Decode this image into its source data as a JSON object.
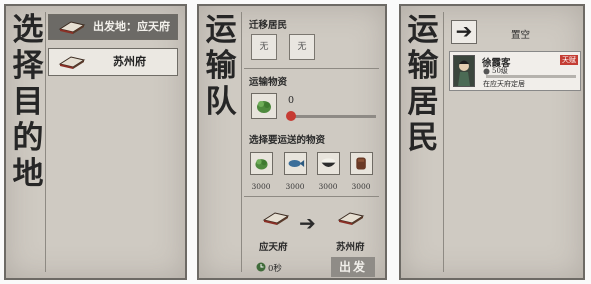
{
  "panel1": {
    "title": [
      "选",
      "择",
      "目",
      "的",
      "地"
    ],
    "origin_label": "出发地：应天府",
    "target_label": "苏州府"
  },
  "panel2": {
    "title": [
      "运",
      "输",
      "队"
    ],
    "migrate_label": "迁移居民",
    "slot_glyph": "无",
    "goods_label": "运输物资",
    "slider_value": "0",
    "choose_label": "选择要运送的物资",
    "goods": [
      {
        "icon": "vegetable-icon",
        "amount": "3000"
      },
      {
        "icon": "fish-icon",
        "amount": "3000"
      },
      {
        "icon": "rice-bowl-icon",
        "amount": "3000"
      },
      {
        "icon": "cloth-bolt-icon",
        "amount": "3000"
      }
    ],
    "from_city": "应天府",
    "to_city": "苏州府",
    "time_label": "0秒",
    "depart_label": "出发"
  },
  "panel3": {
    "title": [
      "运",
      "输",
      "居",
      "民"
    ],
    "empty_label": "置空",
    "resident": {
      "name": "徐霞客",
      "badge": "天赋",
      "count": "50级",
      "status": "在应天府定居"
    }
  },
  "colors": {
    "accent_red": "#c63b33",
    "panel_bg": "#cfcac2",
    "origin_bg": "#6c6a66"
  }
}
